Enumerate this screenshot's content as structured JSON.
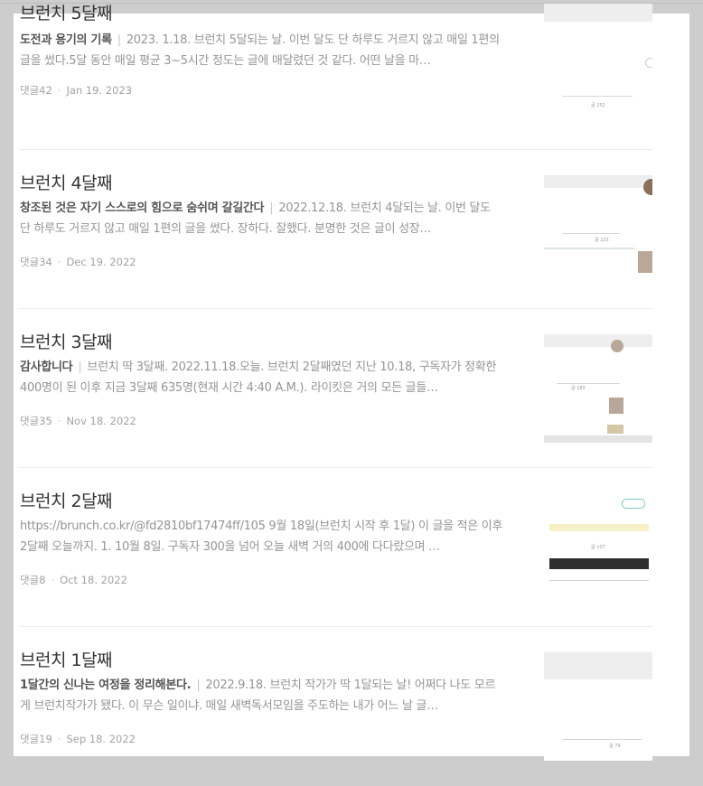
{
  "posts": [
    {
      "title": "브런치 5달째",
      "subtitle": "도전과 용기의 기록",
      "excerpt": "2023. 1.18. 브런치 5달되는 날. 이번 달도 단 하루도 거르지 않고 매일 1편의 글을 썼다.5달 동안 매일 평균 3~5시간 정도는 글에 매달렸던 것 같다. 어떤 날을 마…",
      "comments": "댓글42",
      "date": "Jan 19. 2023",
      "thumb_text": "글 252"
    },
    {
      "title": "브런치 4달째",
      "subtitle": "창조된 것은 자기 스스로의 힘으로 숨쉬며 갈길간다",
      "excerpt": "2022.12.18. 브런치 4달되는 날. 이번 달도 단 하루도 거르지 않고 매일 1편의 글을 썼다. 장하다. 잘했다. 분명한 것은 글이 성장…",
      "comments": "댓글34",
      "date": "Dec 19. 2022",
      "thumb_text": "글 223"
    },
    {
      "title": "브런치 3달째",
      "subtitle": "감사합니다",
      "excerpt": "브런치 딱 3달째. 2022.11.18.오늘. 브런치 2달째였던 지난 10.18, 구독자가 정확한 400명이 된 이후 지금 3달째 635명(현재 시간 4:40 A.M.). 라이킷은 거의 모든 글들…",
      "comments": "댓글35",
      "date": "Nov 18. 2022",
      "thumb_text": "글 183"
    },
    {
      "title": "브런치 2달째",
      "subtitle": "",
      "excerpt": "https://brunch.co.kr/@fd2810bf17474ff/105 9월 18일(브런치 시작 후 1달) 이 글을 적은 이후 2달째 오늘까지. 1. 10월 8일. 구독자 300을 넘어 오늘 새벽 거의 400에 다다랐으며 …",
      "comments": "댓글8",
      "date": "Oct 18. 2022",
      "thumb_text": "글 107"
    },
    {
      "title": "브런치 1달째",
      "subtitle": "1달간의 신나는 여정을 정리해본다.",
      "excerpt": "2022.9.18. 브런치 작가가 딱 1달되는 날! 어쩌다 나도 모르게 브런치작가가 됐다. 이 무슨 일이냐. 매일 새벽독서모임을 주도하는 내가 어느 날 글…",
      "comments": "댓글19",
      "date": "Sep 18. 2022",
      "thumb_text": "글 74"
    }
  ]
}
